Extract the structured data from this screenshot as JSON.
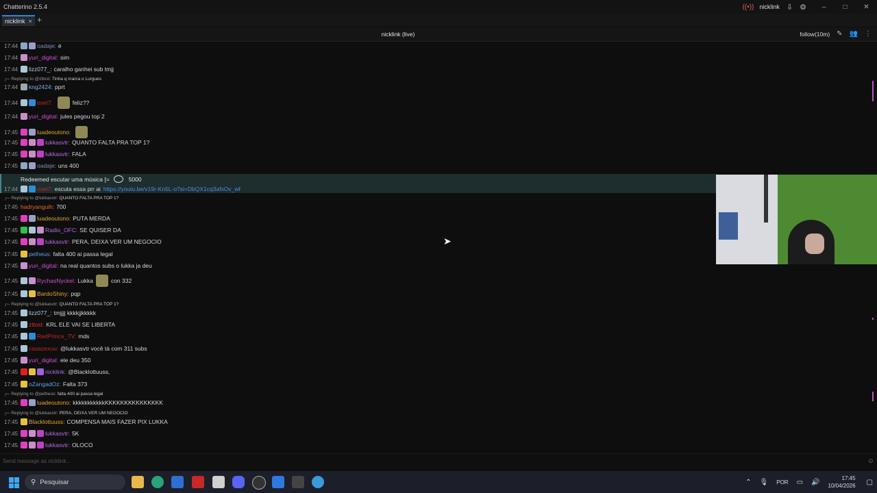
{
  "app": {
    "title": "Chatterino 2.5.4",
    "user": "nicklink"
  },
  "tab": {
    "label": "nicklink",
    "close": "×",
    "add": "+"
  },
  "header": {
    "channel": "nicklink (live)",
    "follow": "follow(10m)"
  },
  "redeem": {
    "text": "Redeemed escutar uma música [=",
    "cost": "5000"
  },
  "input": {
    "placeholder": "Send message as nicklink..."
  },
  "taskbar": {
    "search": "Pesquisar",
    "lang": "POR",
    "time": "17:45",
    "date": "10/04/2026"
  },
  "colors": {
    "accent": "#2f88d6",
    "redeem_bg": "#1e2d2e",
    "link": "#4a8fe0"
  },
  "messages": [
    {
      "ts": "17:44",
      "user": "oadaje",
      "color": "#7d8fb5",
      "text": "é",
      "badges": [
        "#8aa7c8",
        "#9aa0c8"
      ]
    },
    {
      "ts": "17:44",
      "user": "yuri_digital",
      "color": "#d04fd1",
      "text": "sim",
      "badges": [
        "#c98fc9"
      ]
    },
    {
      "ts": "17:44",
      "user": "lizz077_",
      "color": "#b6cbe6",
      "text": "caralho ganhei sub tmjj",
      "badges": [
        "#aac7d8"
      ]
    },
    {
      "reply": "Replying to @ztlost:",
      "ctx": "Tinha q marca o Lurgues"
    },
    {
      "ts": "17:44",
      "user": "kng2424",
      "color": "#7ab3e8",
      "text": "pprt",
      "badges": [
        "#9aa"
      ]
    },
    {
      "ts": "17:44",
      "user": "osel7",
      "color": "#c2262b",
      "text": "feliz??",
      "badges": [
        "#aac7d8",
        "#2b8fd8"
      ],
      "emote": true
    },
    {
      "ts": "17:44",
      "user": "yuri_digital",
      "color": "#d04fd1",
      "text": "jules pegou top 2",
      "badges": [
        "#c98fc9"
      ]
    },
    {
      "ts": "17:45",
      "user": "luadeoutono",
      "color": "#e0a830",
      "text": "",
      "badges": [
        "#e040c0",
        "#9aa0c8"
      ],
      "emote": true
    },
    {
      "ts": "17:45",
      "user": "lukkasvtr",
      "color": "#b46de6",
      "text": "QUANTO FALTA PRA TOP 1?",
      "badges": [
        "#e040c0",
        "#c98fc9",
        "#c040c8"
      ]
    },
    {
      "ts": "17:45",
      "user": "lukkasvtr",
      "color": "#b46de6",
      "text": "FALA",
      "badges": [
        "#e040c0",
        "#c98fc9",
        "#c040c8"
      ]
    },
    {
      "ts": "17:45",
      "user": "oadaje",
      "color": "#7d8fb5",
      "text": "uns 400",
      "badges": [
        "#8aa7c8",
        "#9aa0c8"
      ]
    },
    {
      "ts": "17:44",
      "user": "osel7",
      "color": "#c2262b",
      "text": "escuta essa prr ai",
      "link": "https://youtu.be/v19r-Kn5L-o?si=DbQX1cq3afxOv_wf",
      "badges": [
        "#aac7d8",
        "#2b8fd8"
      ]
    },
    {
      "reply": "Replying to @lukkasvtr:",
      "ctx": "QUANTO FALTA PRA TOP 1?"
    },
    {
      "ts": "17:45",
      "user": "hadryanguih",
      "color": "#e86a2a",
      "text": "700",
      "badges": []
    },
    {
      "ts": "17:45",
      "user": "luadeoutono",
      "color": "#e0a830",
      "text": "PUTA MERDA",
      "badges": [
        "#e040c0",
        "#9aa0c8"
      ]
    },
    {
      "ts": "17:45",
      "user": "Radio_OFC",
      "color": "#b46de6",
      "text": "SE QUISER DA",
      "badges": [
        "#2ec04a",
        "#aac7d8",
        "#c98fc9"
      ]
    },
    {
      "ts": "17:45",
      "user": "lukkasvtr",
      "color": "#b46de6",
      "text": "PERA, DEIXA VER UM NEGOCIO",
      "badges": [
        "#e040c0",
        "#c98fc9",
        "#c040c8"
      ]
    },
    {
      "ts": "17:45",
      "user": "petheus",
      "color": "#5fa0e8",
      "text": "falta 400 ai passa legal",
      "badges": [
        "#e8c040"
      ]
    },
    {
      "ts": "17:45",
      "user": "yuri_digital",
      "color": "#d04fd1",
      "text": "na real quantos subs o lukka ja deu",
      "badges": [
        "#c98fc9"
      ]
    },
    {
      "ts": "17:45",
      "user": "RychasNyckel",
      "color": "#d04fd1",
      "text": "Lukka",
      "text2": "con 332",
      "badges": [
        "#aac7d8",
        "#c98fc9"
      ],
      "emote": true
    },
    {
      "ts": "17:45",
      "user": "BardoShiny",
      "color": "#e0a830",
      "text": "pqp",
      "badges": [
        "#aac7d8",
        "#e8c040"
      ]
    },
    {
      "reply": "Replying to @lukkasvtr:",
      "ctx": "QUANTO FALTA PRA TOP 1?"
    },
    {
      "ts": "17:45",
      "user": "lizz077_",
      "color": "#b6cbe6",
      "text": "tmjjjj kkkkjjkkkkk",
      "badges": [
        "#aac7d8"
      ]
    },
    {
      "ts": "17:45",
      "user": "ztlost",
      "color": "#e82a2a",
      "text": "KRL ELE VAI SE LIBERTA",
      "badges": [
        "#aac7d8"
      ]
    },
    {
      "ts": "17:45",
      "user": "RedPrince_TV",
      "color": "#c2262b",
      "text": "mds",
      "badges": [
        "#aac7d8",
        "#2b8fd8"
      ]
    },
    {
      "ts": "17:45",
      "user": "casazexuu",
      "color": "#c2262b",
      "text": "@lukkasvtr você tá com 311 subs",
      "badges": [
        "#aac7d8"
      ]
    },
    {
      "ts": "17:45",
      "user": "yuri_digital",
      "color": "#d04fd1",
      "text": "ele deu 350",
      "badges": [
        "#c98fc9"
      ]
    },
    {
      "ts": "17:45",
      "user": "nicklink",
      "color": "#b46de6",
      "text": "@Blacklottuuss,",
      "badges": [
        "#e02020",
        "#e8c040",
        "#a060e0"
      ]
    },
    {
      "ts": "17:45",
      "user": "oZangadOz",
      "color": "#5fa0e8",
      "text": "Falta 373",
      "badges": [
        "#e8c040"
      ]
    },
    {
      "reply": "Replying to @petheus:",
      "ctx": "falta 400 ai passa legal"
    },
    {
      "ts": "17:45",
      "user": "luadeoutono",
      "color": "#e0a830",
      "text": "kkkkkkkkkkkKKKKKKKKKKKKKKK",
      "badges": [
        "#e040c0",
        "#9aa0c8"
      ]
    },
    {
      "reply": "Replying to @lukkasvtr:",
      "ctx": "PERA, DEIXA VER UM NEGOCIO"
    },
    {
      "ts": "17:45",
      "user": "Blacklottuuss",
      "color": "#e0a830",
      "text": "COMPENSA MAIS FAZER PIX LUKKA",
      "badges": [
        "#e8c040"
      ]
    },
    {
      "ts": "17:45",
      "user": "lukkasvtr",
      "color": "#b46de6",
      "text": "5K",
      "badges": [
        "#e040c0",
        "#c98fc9",
        "#c040c8"
      ]
    },
    {
      "ts": "17:45",
      "user": "lukkasvtr",
      "color": "#b46de6",
      "text": "OLOCO",
      "badges": [
        "#e040c0",
        "#c98fc9",
        "#c040c8"
      ]
    }
  ]
}
